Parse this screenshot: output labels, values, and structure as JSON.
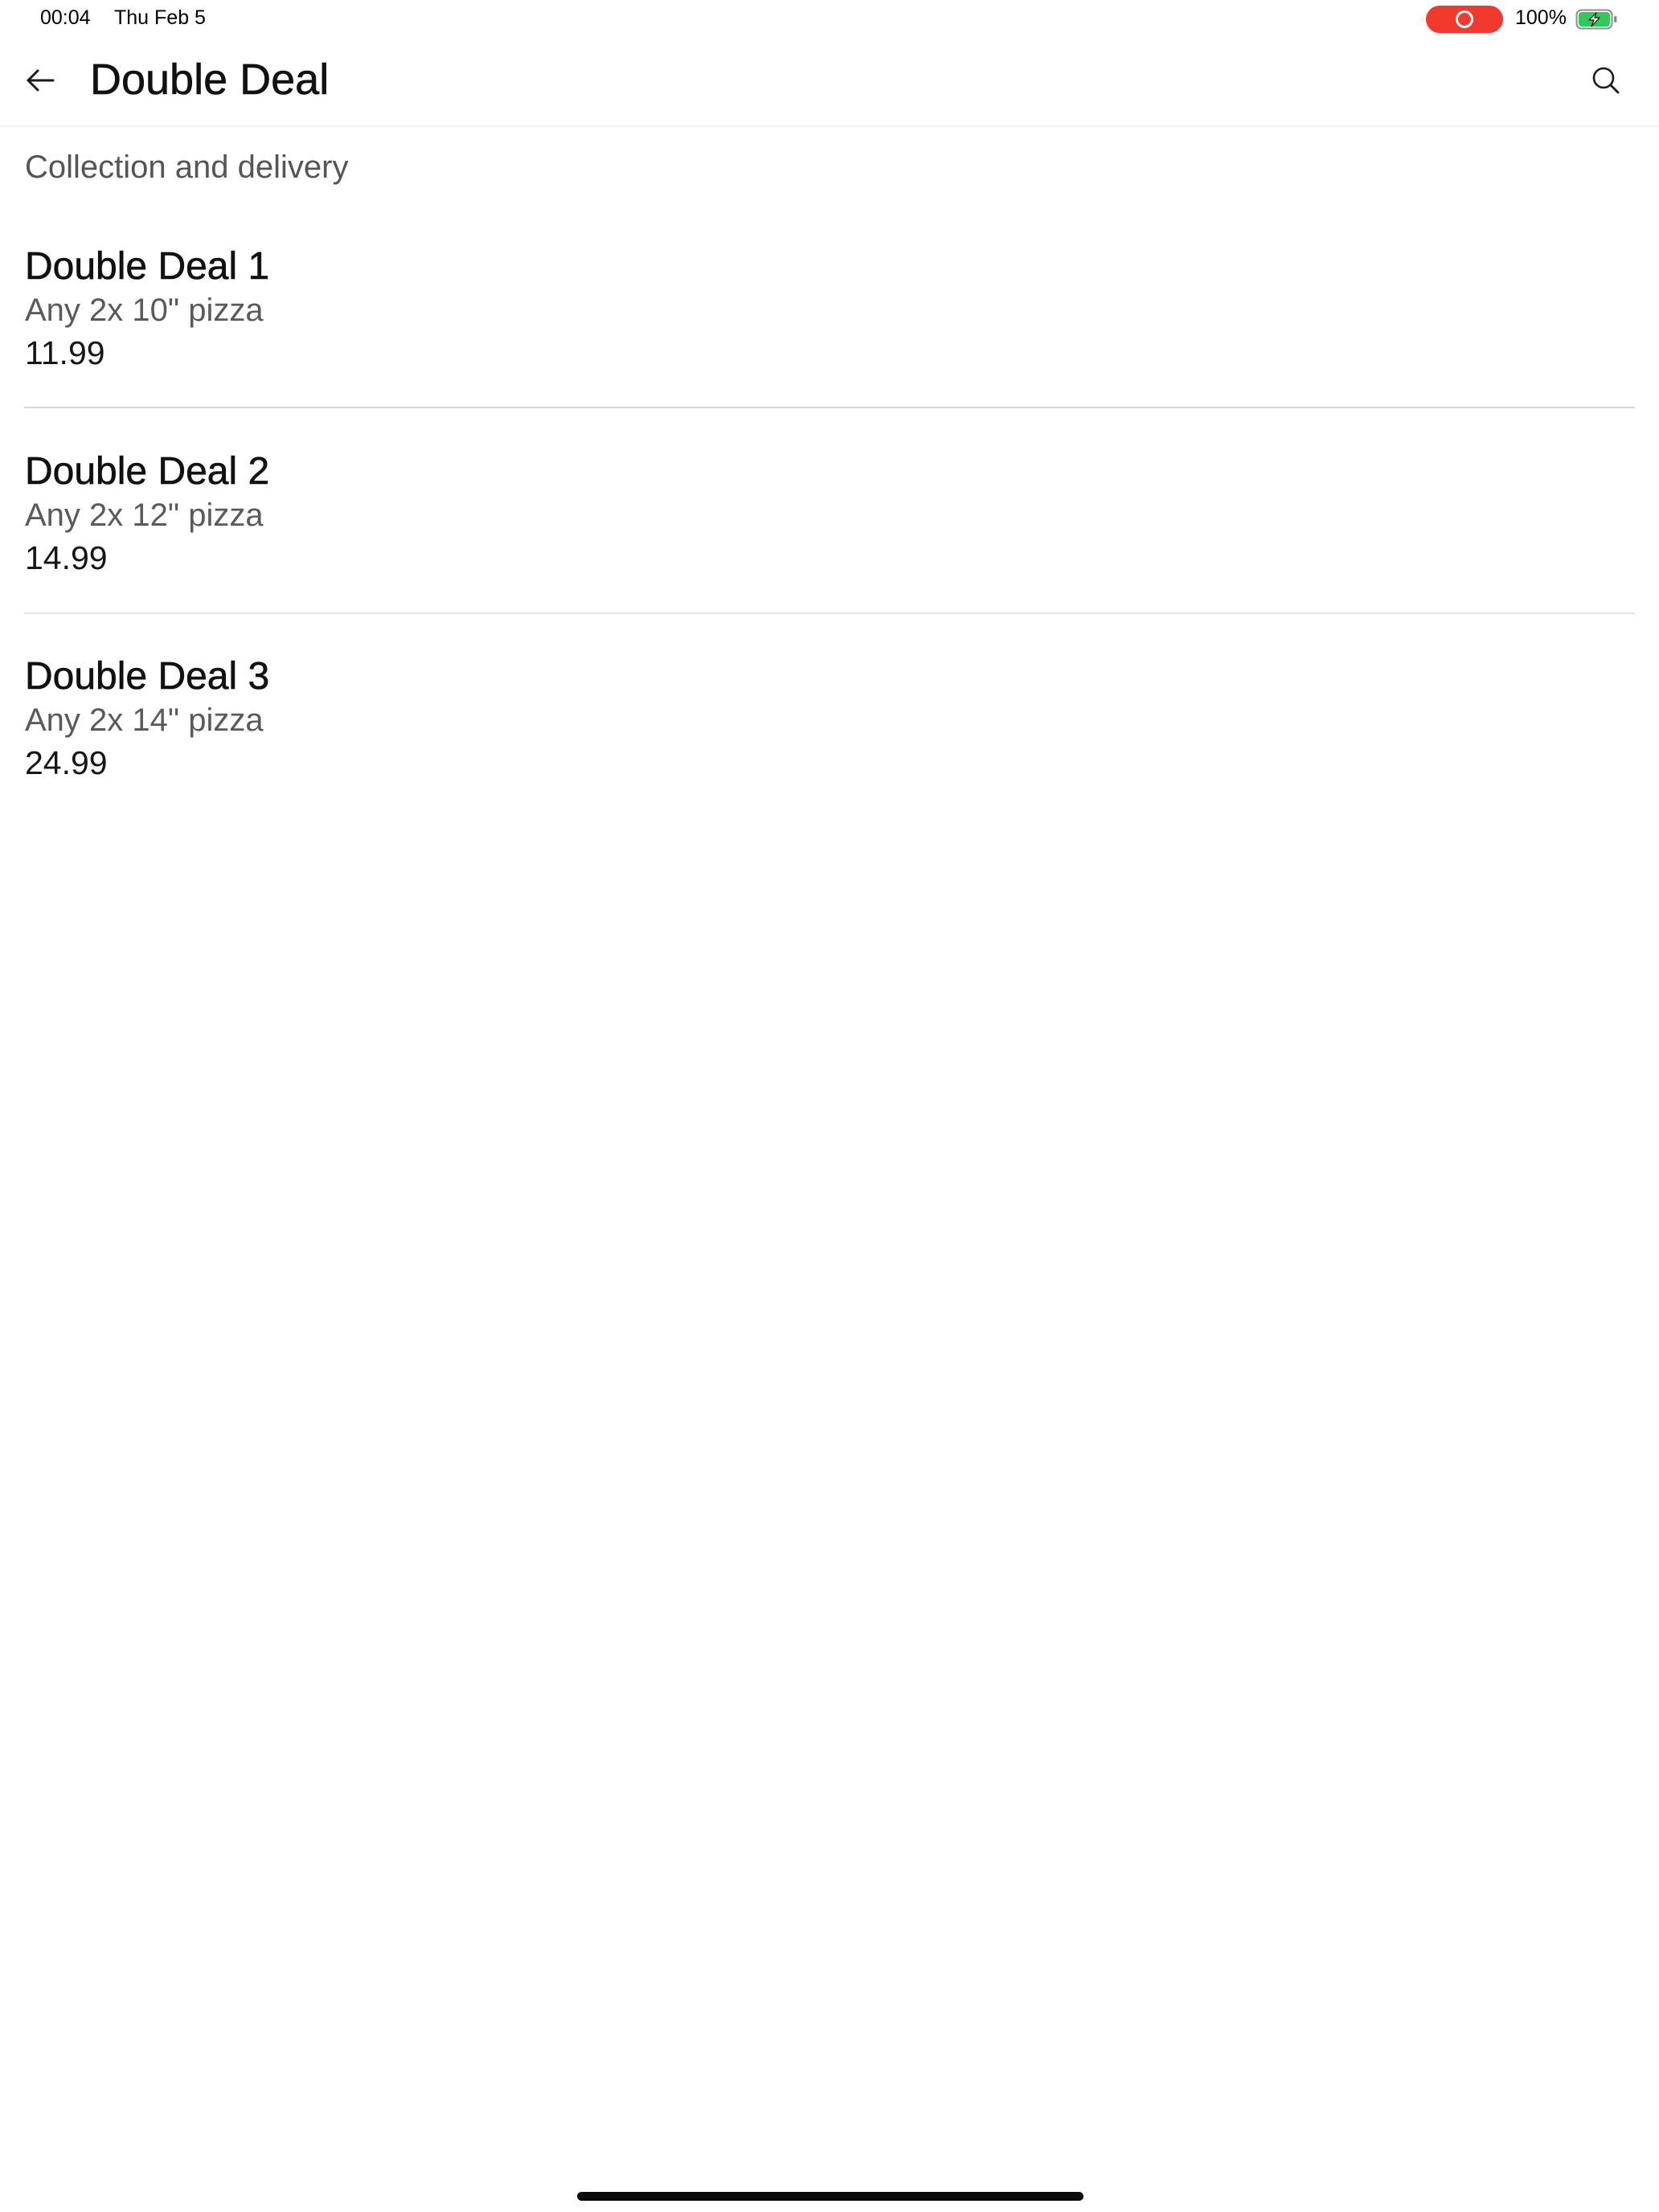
{
  "status_bar": {
    "time": "00:04",
    "date": "Thu Feb 5",
    "battery_percent": "100%",
    "battery_level": 1.0,
    "battery_charging": true,
    "screen_recording": true,
    "recording_color": "#f03a2e",
    "battery_color": "#34c759"
  },
  "app_bar": {
    "back_icon": "arrow-left-icon",
    "title": "Double Deal",
    "search_icon": "search-icon"
  },
  "section": {
    "label": "Collection and delivery"
  },
  "deals": [
    {
      "name": "Double Deal 1",
      "description": "Any 2x 10\" pizza",
      "price": "11.99"
    },
    {
      "name": "Double Deal 2",
      "description": "Any 2x 12\" pizza",
      "price": "14.99"
    },
    {
      "name": "Double Deal 3",
      "description": "Any 2x 14\" pizza",
      "price": "24.99"
    }
  ]
}
